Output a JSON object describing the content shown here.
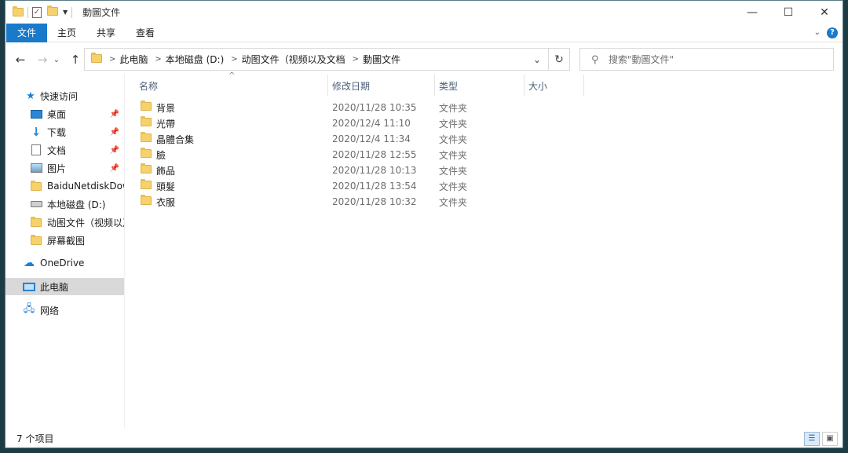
{
  "window": {
    "title": "動圖文件",
    "minimize_glyph": "—",
    "maximize_glyph": "☐",
    "close_glyph": "✕"
  },
  "ribbon": {
    "tabs": [
      "文件",
      "主页",
      "共享",
      "查看"
    ],
    "expand_glyph": "⌄",
    "help_glyph": "?"
  },
  "address": {
    "back_glyph": "←",
    "forward_glyph": "→",
    "recent_glyph": "⌄",
    "up_glyph": "↑",
    "crumbs": [
      "此电脑",
      "本地磁盘 (D:)",
      "动图文件（视频以及文档",
      "動圖文件"
    ],
    "separator": ">",
    "dropdown_glyph": "⌄",
    "refresh_glyph": "↻"
  },
  "search": {
    "placeholder": "搜索\"動圖文件\""
  },
  "nav": {
    "items": [
      {
        "label": "快速访问",
        "icon": "star-icon"
      },
      {
        "label": "桌面",
        "icon": "desktop-icon",
        "pinned": true
      },
      {
        "label": "下载",
        "icon": "download-icon",
        "pinned": true
      },
      {
        "label": "文档",
        "icon": "document-icon",
        "pinned": true
      },
      {
        "label": "图片",
        "icon": "pictures-icon",
        "pinned": true
      },
      {
        "label": "BaiduNetdiskDow",
        "icon": "folder-icon"
      },
      {
        "label": "本地磁盘 (D:)",
        "icon": "drive-icon"
      },
      {
        "label": "动图文件（视频以及",
        "icon": "folder-icon"
      },
      {
        "label": "屏幕截图",
        "icon": "folder-icon"
      },
      {
        "label": "OneDrive",
        "icon": "cloud-icon"
      },
      {
        "label": "此电脑",
        "icon": "computer-icon",
        "selected": true
      },
      {
        "label": "网络",
        "icon": "network-icon"
      }
    ],
    "pin_glyph": "📌"
  },
  "columns": {
    "name": "名称",
    "date": "修改日期",
    "type": "类型",
    "size": "大小"
  },
  "files": [
    {
      "name": "背景",
      "date": "2020/11/28 10:35",
      "type": "文件夹"
    },
    {
      "name": "光帶",
      "date": "2020/12/4 11:10",
      "type": "文件夹"
    },
    {
      "name": "晶體合集",
      "date": "2020/12/4 11:34",
      "type": "文件夹"
    },
    {
      "name": "臉",
      "date": "2020/11/28 12:55",
      "type": "文件夹"
    },
    {
      "name": "飾品",
      "date": "2020/11/28 10:13",
      "type": "文件夹"
    },
    {
      "name": "頭髮",
      "date": "2020/11/28 13:54",
      "type": "文件夹"
    },
    {
      "name": "衣服",
      "date": "2020/11/28 10:32",
      "type": "文件夹"
    }
  ],
  "status": {
    "item_count": "7 个项目"
  },
  "colors": {
    "accent": "#1979ca",
    "folder": "#f6d26d",
    "selected_nav": "#d9d9d9"
  }
}
